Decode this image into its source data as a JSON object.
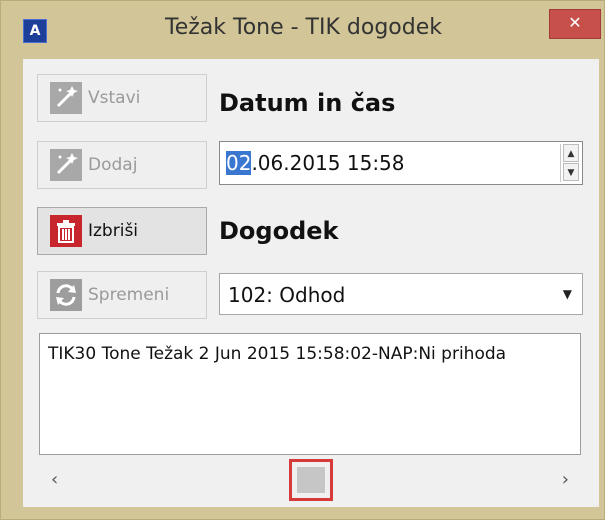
{
  "window": {
    "title": "Težak Tone - TIK dogodek",
    "app_icon_letter": "A",
    "close_glyph": "✕"
  },
  "buttons": {
    "insert": {
      "label": "Vstavi",
      "icon": "magic-wand-icon",
      "enabled": false
    },
    "add": {
      "label": "Dodaj",
      "icon": "magic-wand-icon",
      "enabled": false
    },
    "delete": {
      "label": "Izbriši",
      "icon": "trash-icon",
      "enabled": true
    },
    "change": {
      "label": "Spremeni",
      "icon": "refresh-icon",
      "enabled": false
    }
  },
  "datetime": {
    "heading": "Datum in čas",
    "selected_part": "02",
    "rest": ".06.2015 15:58",
    "spin_up": "▲",
    "spin_down": "▼"
  },
  "event": {
    "heading": "Dogodek",
    "selected_value": "102: Odhod",
    "dropdown_glyph": "▼"
  },
  "notes": {
    "text": "TIK30 Tone Težak 2 Jun 2015 15:58:02-NAP:Ni prihoda"
  },
  "scroll": {
    "left": "‹",
    "right": "›"
  },
  "colors": {
    "frame": "#d2c597",
    "close": "#c7504a",
    "delete_icon": "#c8262d",
    "selection": "#3a77d1",
    "highlight": "#d63a3a"
  }
}
